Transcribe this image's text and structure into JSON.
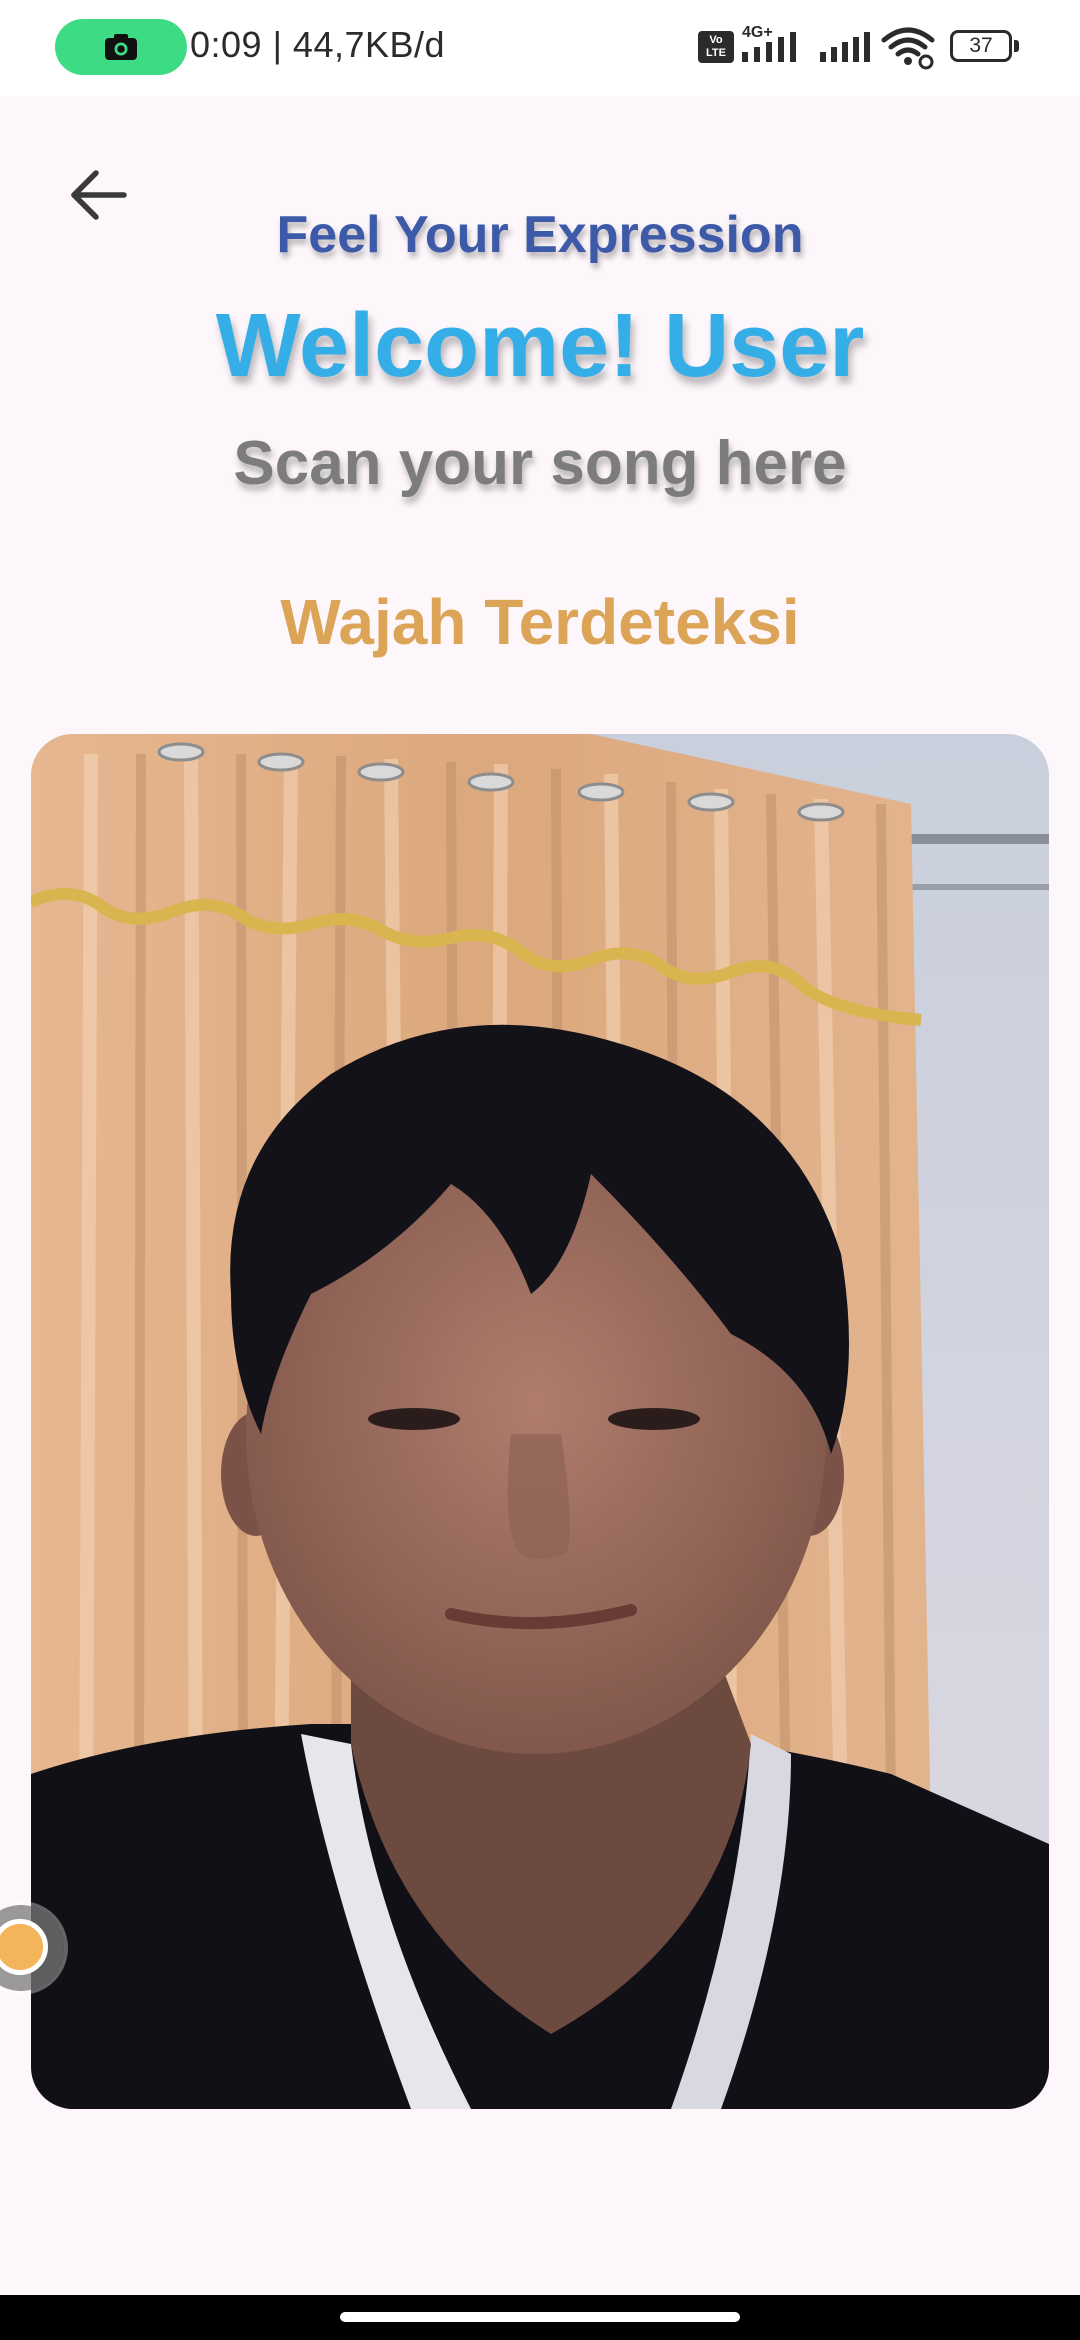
{
  "status_bar": {
    "time_speed": "0:09 | 44,7KB/d",
    "volte_label": "Vo\nLTE",
    "network_type": "4G+",
    "battery_level": "37",
    "recording_icon": "camera-icon",
    "recording_pill_color": "#3ddc84"
  },
  "header": {
    "back_icon": "arrow-left-icon",
    "tagline": "Feel Your Expression",
    "welcome": "Welcome! User",
    "subtitle": "Scan your song here"
  },
  "detection": {
    "status_text": "Wajah Terdeteksi",
    "status_color": "#dba457"
  },
  "camera": {
    "content": "live-camera-feed"
  },
  "colors": {
    "tagline": "#3d5aa8",
    "welcome": "#35aee8",
    "subtitle": "#7c7c7c",
    "background": "#fdf7fb"
  }
}
